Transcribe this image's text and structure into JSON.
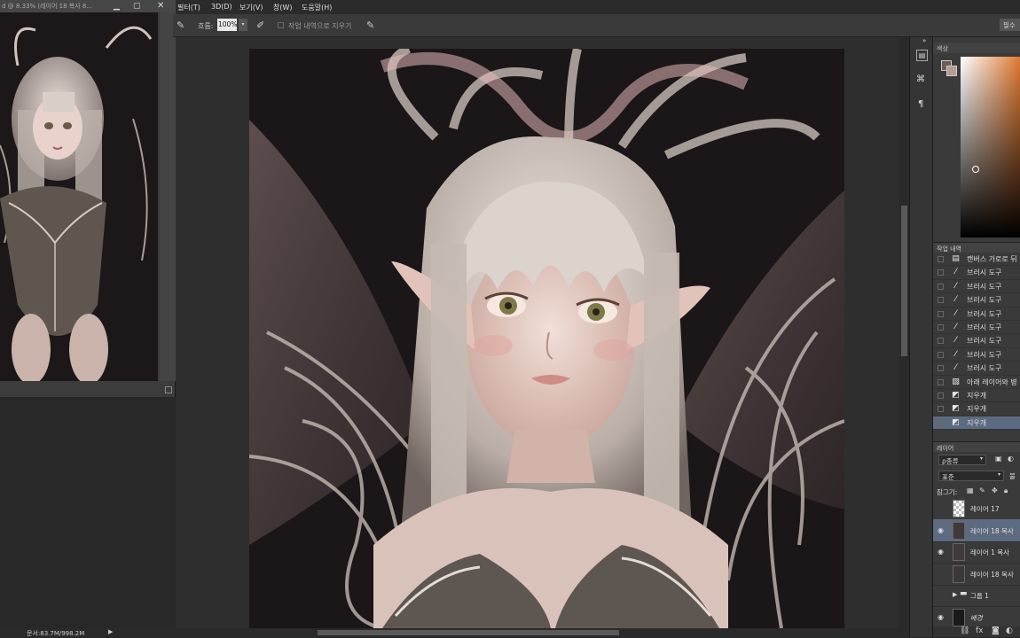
{
  "menubar": {
    "items": [
      "필터(T)",
      "3D(D)",
      "보기(V)",
      "창(W)",
      "도움말(H)"
    ],
    "right_button": "필수"
  },
  "options_bar": {
    "flow_label": "흐름:",
    "flow_value": "100%",
    "erase_to_history_label": "작업 내역으로 지우기"
  },
  "navigator": {
    "title": "d @ 8.33% (레이어 18 복사 8..."
  },
  "status": {
    "doc_size": "문서:83.7M/998.2M"
  },
  "panels": {
    "color_tab": "색상",
    "history_tab": "작업 내역",
    "layers_tab": "레이어"
  },
  "history": {
    "items": [
      {
        "label": "캔버스 가로로 뒤",
        "icon": "canvas-icon"
      },
      {
        "label": "브러시 도구",
        "icon": "brush-icon"
      },
      {
        "label": "브러시 도구",
        "icon": "brush-icon"
      },
      {
        "label": "브러시 도구",
        "icon": "brush-icon"
      },
      {
        "label": "브러시 도구",
        "icon": "brush-icon"
      },
      {
        "label": "브러시 도구",
        "icon": "brush-icon"
      },
      {
        "label": "브러시 도구",
        "icon": "brush-icon"
      },
      {
        "label": "브러시 도구",
        "icon": "brush-icon"
      },
      {
        "label": "브러시 도구",
        "icon": "brush-icon"
      },
      {
        "label": "아래 레이어와 병",
        "icon": "merge-icon"
      },
      {
        "label": "지우개",
        "icon": "eraser-icon"
      },
      {
        "label": "지우개",
        "icon": "eraser-icon"
      },
      {
        "label": "지우개",
        "icon": "eraser-icon"
      }
    ],
    "selected_index": 12
  },
  "layers": {
    "filter_label": "ρ종류",
    "blend_mode": "표준",
    "opacity_label": "불",
    "lock_label": "잠그기:",
    "items": [
      {
        "name": "레이어 17",
        "visible": false
      },
      {
        "name": "레이어 18 복사",
        "visible": true,
        "selected": true
      },
      {
        "name": "레이어 1 복사",
        "visible": true
      },
      {
        "name": "레이어 18 복사",
        "visible": false
      },
      {
        "name": "그룹 1",
        "visible": false,
        "group": true
      },
      {
        "name": "배경",
        "visible": true
      }
    ]
  },
  "colors": {
    "selected_row": "#5d6b80",
    "panel_bg": "#3a3a3a",
    "accent_orange": "#d9722e"
  }
}
